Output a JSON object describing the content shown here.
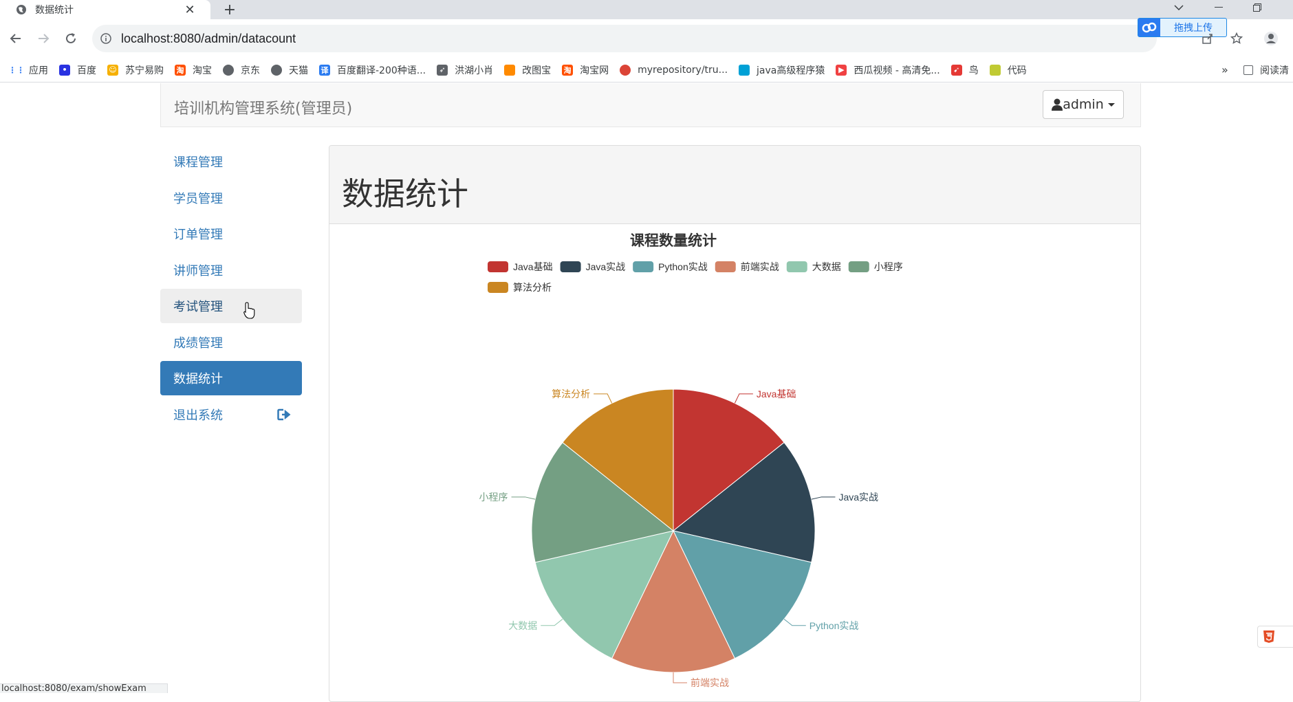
{
  "browser": {
    "tab": {
      "title": "数据统计"
    },
    "url": "localhost:8080/admin/datacount",
    "baidu_upload": "拖拽上传",
    "bookmarks": [
      {
        "label": "应用",
        "icon": "apps-grid-icon",
        "color": "#4285f4"
      },
      {
        "label": "百度",
        "icon": "baidu-paw-icon",
        "color": "#2932e1"
      },
      {
        "label": "苏宁易购",
        "icon": "suning-icon",
        "color": "#f6b000"
      },
      {
        "label": "淘宝",
        "icon": "taobao-icon",
        "color": "#ff5000"
      },
      {
        "label": "京东",
        "icon": "globe-icon",
        "color": "#5f6368"
      },
      {
        "label": "天猫",
        "icon": "globe-icon",
        "color": "#5f6368"
      },
      {
        "label": "百度翻译-200种语...",
        "icon": "translate-icon",
        "color": "#2b7bf0"
      },
      {
        "label": "洪湖小肖",
        "icon": "rocket-icon",
        "color": "#5f6368"
      },
      {
        "label": "改图宝",
        "icon": "gaitubao-icon",
        "color": "#ff8a00"
      },
      {
        "label": "淘宝网",
        "icon": "taobao-icon",
        "color": "#ff5000"
      },
      {
        "label": "myrepository/tru...",
        "icon": "chrome-icon",
        "color": "#db4437"
      },
      {
        "label": "java高级程序猿",
        "icon": "bilibili-icon",
        "color": "#00a1d6"
      },
      {
        "label": "西瓜视频 - 高清免...",
        "icon": "xigua-icon",
        "color": "#f04142"
      },
      {
        "label": "鸟",
        "icon": "bird-icon",
        "color": "#e53935"
      },
      {
        "label": "代码",
        "icon": "code-icon",
        "color": "#c0ca33"
      }
    ],
    "more_bookmarks": "»",
    "reading_list": "阅读清",
    "status_url": "localhost:8080/exam/showExam"
  },
  "navbar": {
    "brand": "培训机构管理系统(管理员)",
    "user": "admin"
  },
  "sidebar": {
    "items": [
      {
        "label": "课程管理",
        "state": "normal"
      },
      {
        "label": "学员管理",
        "state": "normal"
      },
      {
        "label": "订单管理",
        "state": "normal"
      },
      {
        "label": "讲师管理",
        "state": "normal"
      },
      {
        "label": "考试管理",
        "state": "hover"
      },
      {
        "label": "成绩管理",
        "state": "normal"
      },
      {
        "label": "数据统计",
        "state": "active"
      },
      {
        "label": "退出系统",
        "state": "normal"
      }
    ]
  },
  "main": {
    "title": "数据统计"
  },
  "chart_data": {
    "type": "pie",
    "title": "课程数量统计",
    "legend_position": "top-center",
    "categories": [
      "Java基础",
      "Java实战",
      "Python实战",
      "前端实战",
      "大数据",
      "小程序",
      "算法分析"
    ],
    "values": [
      1,
      1,
      1,
      1,
      1,
      1,
      1
    ],
    "colors": [
      "#c23531",
      "#2f4554",
      "#61a0a8",
      "#d48265",
      "#91c7ae",
      "#749f83",
      "#ca8622"
    ]
  }
}
